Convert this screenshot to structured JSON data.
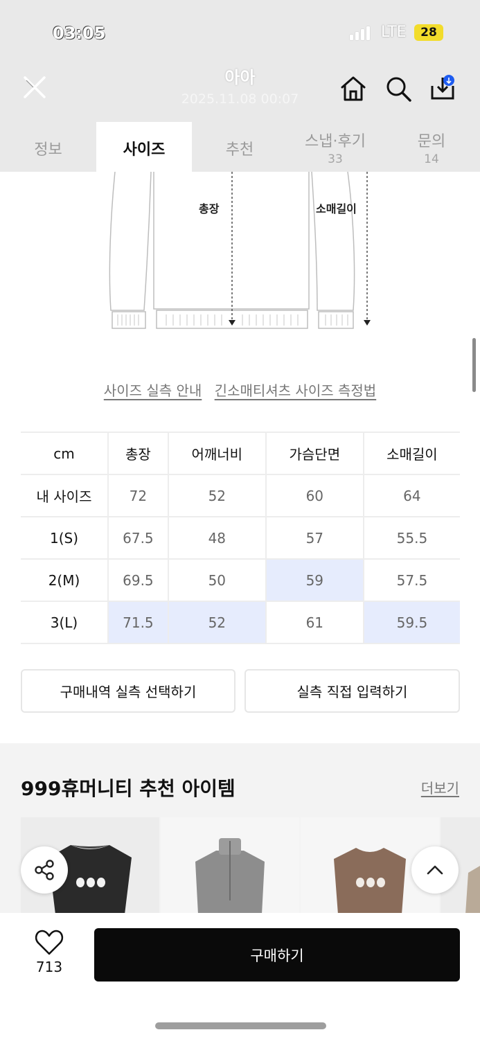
{
  "status": {
    "time": "03:05",
    "network": "LTE",
    "battery": "28"
  },
  "header": {
    "title": "아아",
    "subtitle": "2025.11.08 00:07"
  },
  "tabs": [
    {
      "label": "정보",
      "count": ""
    },
    {
      "label": "사이즈",
      "count": ""
    },
    {
      "label": "추천",
      "count": ""
    },
    {
      "label": "스냅·후기",
      "count": "33"
    },
    {
      "label": "문의",
      "count": "14"
    }
  ],
  "diagram": {
    "label_length": "총장",
    "label_sleeve": "소매길이"
  },
  "links": {
    "guide": "사이즈 실측 안내",
    "measure": "긴소매티셔츠 사이즈 측정법"
  },
  "size_table": {
    "headers": [
      "cm",
      "총장",
      "어깨너비",
      "가슴단면",
      "소매길이"
    ],
    "rows": [
      {
        "name": "내 사이즈",
        "values": [
          "72",
          "52",
          "60",
          "64"
        ]
      },
      {
        "name": "1(S)",
        "values": [
          "67.5",
          "48",
          "57",
          "55.5"
        ]
      },
      {
        "name": "2(M)",
        "values": [
          "69.5",
          "50",
          "59",
          "57.5"
        ]
      },
      {
        "name": "3(L)",
        "values": [
          "71.5",
          "52",
          "61",
          "59.5"
        ]
      }
    ],
    "highlight_color": "#e6ecfd"
  },
  "buttons": {
    "purchase_history": "구매내역 실측 선택하기",
    "manual_input": "실측 직접 입력하기"
  },
  "recommend": {
    "title": "999휴머니티 추천 아이템",
    "more": "더보기",
    "logo_text": "999"
  },
  "bottom": {
    "likes": "713",
    "buy": "구매하기"
  }
}
